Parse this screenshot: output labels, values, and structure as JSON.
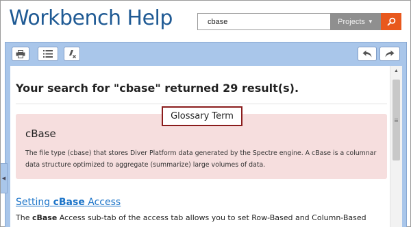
{
  "header": {
    "app_title": "Workbench Help",
    "search_value": "cbase",
    "projects_label": "Projects",
    "projects_caret": "▼",
    "go_icon": "search-icon"
  },
  "toolbar": {
    "left_icons": [
      "print-icon",
      "toc-list-icon",
      "clear-highlight-icon"
    ],
    "right_icons": [
      "back-arrow-icon",
      "forward-arrow-icon"
    ]
  },
  "results": {
    "heading": "Your search for \"cbase\" returned 29 result(s).",
    "callout_label": "Glossary Term",
    "glossary": {
      "term": "cBase",
      "definition": "The file type (cbase) that stores Diver Platform data generated by the Spectre engine. A cBase is a columnar data structure optimized to aggregate (summarize) large volumes of data.",
      "background": "#f6dede"
    },
    "first_result": {
      "title_prefix": "Setting ",
      "title_highlight": "cBase",
      "title_suffix": " Access",
      "snippet_prefix": "The ",
      "snippet_highlight": "cBase",
      "snippet_suffix": " Access sub-tab of the access tab allows you to set Row-Based and Column-Based"
    }
  },
  "colors": {
    "title_blue": "#1f5a94",
    "frame_blue": "#a9c6ea",
    "go_orange": "#e8581d",
    "projects_gray": "#8f8f8f",
    "link_blue": "#1a73c8",
    "callout_border": "#8a1c1c"
  }
}
